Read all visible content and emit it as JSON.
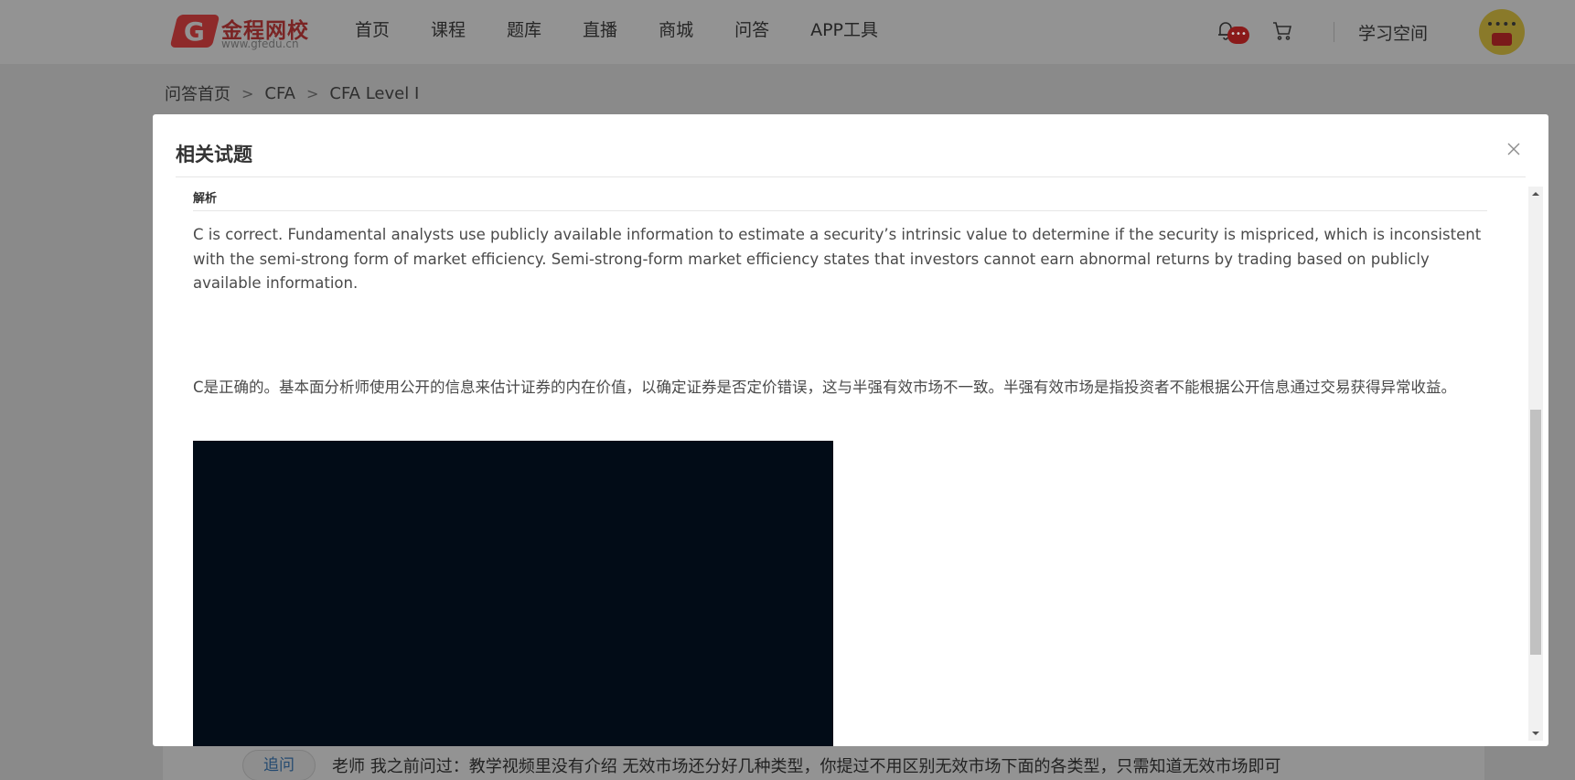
{
  "header": {
    "logo_name": "金程网校",
    "logo_url": "www.gfedu.cn",
    "nav": [
      "首页",
      "课程",
      "题库",
      "直播",
      "商城",
      "问答",
      "APP工具"
    ],
    "notification_badge": "•••",
    "study_space": "学习空间"
  },
  "breadcrumb": [
    "问答首页",
    "CFA",
    "CFA Level I"
  ],
  "modal": {
    "title": "相关试题",
    "section_label": "解析",
    "explanation_en": "C is correct. Fundamental analysts use publicly available information to estimate a security’s intrinsic value to determine if the security is mispriced, which is inconsistent with the semi-strong form of market efficiency. Semi-strong-form market efficiency states that investors cannot earn abnormal returns by trading based on publicly available information.",
    "explanation_zh": "C是正确的。基本面分析师使用公开的信息来估计证券的内在价值，以确定证券是否定价错误，这与半强有效市场不一致。半强有效市场是指投资者不能根据公开信息通过交易获得异常收益。"
  },
  "followup": {
    "button_label": "追问",
    "text": "老师 我之前问过：教学视频里没有介绍 无效市场还分好几种类型，你提过不用区别无效市场下面的各类型，只需知道无效市场即可"
  },
  "colors": {
    "overlay_page": "#939393",
    "modal_bg": "#ffffff",
    "media_block": "#020c17",
    "brand_red": "#c0383a"
  }
}
